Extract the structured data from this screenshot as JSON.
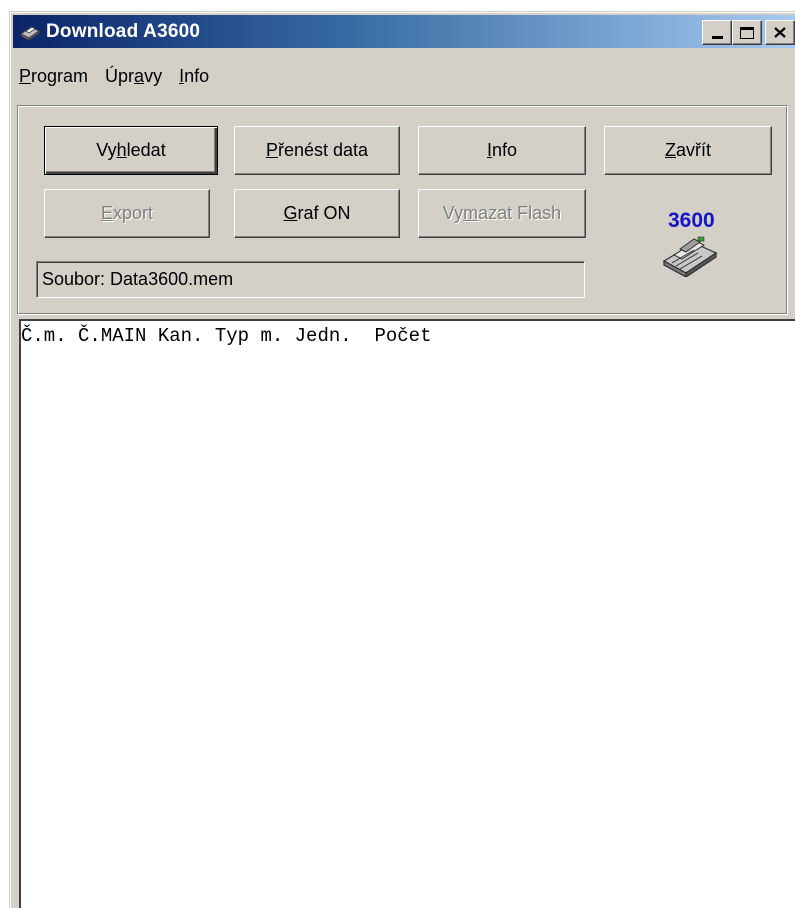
{
  "window": {
    "title": "Download A3600",
    "title_icon": "printer-icon",
    "caption_buttons": [
      "minimize",
      "maximize",
      "close"
    ]
  },
  "menubar": {
    "items": [
      {
        "label": "rogram",
        "accel": "P"
      },
      {
        "label_pre": "Úpr",
        "accel": "a",
        "label_post": "vy"
      },
      {
        "label": "nfo",
        "accel": "I"
      }
    ]
  },
  "toolbar": {
    "vyhledat": {
      "pre": "Vy",
      "accel": "h",
      "post": "ledat"
    },
    "prenest": {
      "pre": "",
      "accel": "P",
      "post": "řenést data"
    },
    "info": {
      "pre": "",
      "accel": "I",
      "post": "nfo"
    },
    "zavrit": {
      "pre": "",
      "accel": "Z",
      "post": "avřít"
    },
    "export": {
      "pre": "",
      "accel": "E",
      "post": "xport"
    },
    "graf": {
      "pre": "",
      "accel": "G",
      "post": "raf ON"
    },
    "vymazat": {
      "pre": "Vy",
      "accel": "m",
      "post": "azat Flash"
    }
  },
  "status": {
    "file": "Soubor: Data3600.mem"
  },
  "logo": {
    "text": "3600",
    "color": "#1414c8"
  },
  "output": {
    "header": "Č.m. Č.MAIN Kan. Typ m. Jedn.  Počet"
  }
}
